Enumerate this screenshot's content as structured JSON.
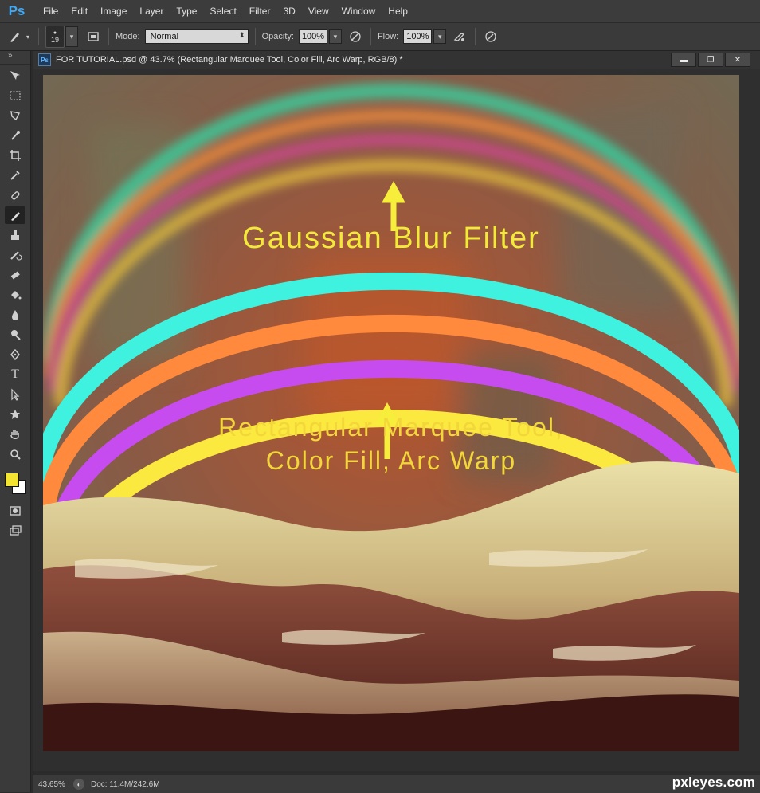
{
  "app": {
    "logo": "Ps"
  },
  "menu": [
    "File",
    "Edit",
    "Image",
    "Layer",
    "Type",
    "Select",
    "Filter",
    "3D",
    "View",
    "Window",
    "Help"
  ],
  "options": {
    "brush_size": "19",
    "mode_label": "Mode:",
    "mode_value": "Normal",
    "opacity_label": "Opacity:",
    "opacity_value": "100%",
    "flow_label": "Flow:",
    "flow_value": "100%"
  },
  "document": {
    "tab_title": "FOR TUTORIAL.psd @ 43.7% (Rectangular Marquee Tool, Color Fill, Arc Warp, RGB/8) *",
    "tab_icon": "Ps"
  },
  "canvas": {
    "upper_label": "Gaussian Blur Filter",
    "lower_label_line1": "Rectangular Marquee Tool,",
    "lower_label_line2": "Color Fill, Arc Warp",
    "arc_colors": [
      "#3ff2e0",
      "#ff8a3d",
      "#c64cf0",
      "#fbe940"
    ],
    "arrow_color": "#f6ee3a"
  },
  "status": {
    "zoom": "43.65%",
    "doc_info": "Doc: 11.4M/242.6M"
  },
  "watermark": "pxleyes.com",
  "colors": {
    "foreground": "#f2e430",
    "background": "#ffffff"
  }
}
